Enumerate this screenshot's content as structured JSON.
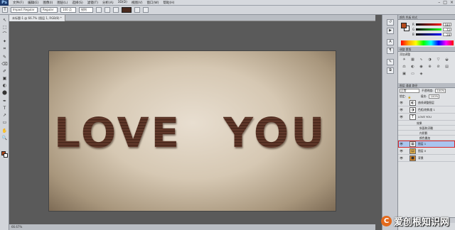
{
  "app": {
    "logo": "Ps"
  },
  "menubar": {
    "items": [
      "文件(F)",
      "编辑(E)",
      "图像(I)",
      "图层(L)",
      "选择(S)",
      "滤镜(T)",
      "分析(A)",
      "3D(D)",
      "视图(V)",
      "窗口(W)",
      "帮助(H)"
    ]
  },
  "options": {
    "tool_glyph": "T",
    "font_family": "Impact Regular",
    "font_style": "Regular",
    "font_size": "100 点",
    "antialias": "锐利",
    "text_color": "#4a2a1e"
  },
  "document": {
    "tab_label": "未标题-1 @ 66.7% (图层 1, RGB/8) *",
    "status_text": "66.67%"
  },
  "canvas": {
    "words": [
      "LOVE",
      "YOU"
    ]
  },
  "tools": [
    "↖",
    "⬚",
    "⌒",
    "✦",
    "⌗",
    "✎",
    "⌫",
    "✐",
    "▣",
    "◐",
    "⬤",
    "✒",
    "T",
    "↗",
    "▭",
    "✋",
    "🔍"
  ],
  "colors": {
    "foreground": "#b54a1c",
    "background": "#ffffff"
  },
  "color_panel": {
    "tabs": "颜色  色板  样式",
    "r": {
      "label": "R",
      "value": "180"
    },
    "g": {
      "label": "G",
      "value": "72"
    },
    "b": {
      "label": "B",
      "value": "28"
    }
  },
  "adjustments": {
    "tabs": "调整  蒙版",
    "title": "添加调整"
  },
  "layers_panel": {
    "tabs": "图层  通道  路径",
    "blend_mode": "正常",
    "opacity_label": "不透明度:",
    "opacity": "100%",
    "lock_label": "锁定:",
    "fill_label": "填充:",
    "fill": "100%",
    "layers": [
      {
        "name": "曲线调整图层",
        "thumb": "◐"
      },
      {
        "name": "色相/饱和度 1",
        "thumb": "◑"
      },
      {
        "name": "LOVE   YOU",
        "thumb": "T"
      },
      {
        "name": "效果",
        "sub": true
      },
      {
        "name": "斜面和浮雕",
        "sub": true
      },
      {
        "name": "内阴影",
        "sub": true
      },
      {
        "name": "颜色叠加",
        "sub": true
      },
      {
        "name": "图层 1",
        "thumb": "▦",
        "selected": true
      },
      {
        "name": "图层 0",
        "thumb": "▤"
      },
      {
        "name": "背景",
        "thumb": "■"
      }
    ],
    "footer_icons": [
      "⛓",
      "fx",
      "◙",
      "◐",
      "▭",
      "▣",
      "🗑"
    ]
  },
  "watermark": {
    "logo": "C",
    "text": "爱创根知识网"
  }
}
